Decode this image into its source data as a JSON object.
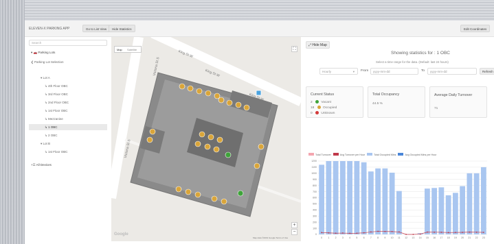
{
  "navbar": {
    "brand": "ELEVEN-X PARKING APP",
    "list_view_label": "Go to List View",
    "hide_stats_label": "Hide Statistics",
    "edit_coords_label": "Edit Coordinates"
  },
  "sidebar": {
    "search_placeholder": "Search",
    "parking_lots": "▾ 🚗 Parking Lots",
    "lot_selection": "❮ Parking Lot Selection",
    "lot_a": "▾ Lot A",
    "floors_a": [
      "↳ 4th Floor OBC",
      "↳ 3rd Floor OBC",
      "↳ 2nd Floor OBC",
      "↳ 1st Floor OBC",
      "↳ Mezzanine",
      "↳ 1 OBC",
      "↳ 2 OBC"
    ],
    "lot_b": "▾ Lot B",
    "floors_b": [
      "↳ 1st Floor OBC"
    ],
    "all_devices": "+☰ All Devices"
  },
  "map": {
    "tab_map": "Map",
    "tab_satellite": "Satellite",
    "streets": [
      "King St W",
      "King St W",
      "King St W",
      "Victoria St S",
      "Victoria St S"
    ],
    "attribution": "Map data ©2019 Google   Terms of Use",
    "google": "Google",
    "zoom_in": "+",
    "zoom_out": "−"
  },
  "panel": {
    "hide_map_label": "⤢ Hide Map",
    "title": "Showing statistics for : 1 OBC",
    "subtitle": "Select a time range for the data. (Default: last 24 hours)",
    "range_select": "Hourly",
    "from_label": "From",
    "from_placeholder": "yyyy-mm-dd",
    "to_label": "To",
    "to_placeholder": "yyyy-mm-dd",
    "refresh_label": "Refresh",
    "current_status": {
      "title": "Current Status",
      "vacant_count": "2",
      "vacant_label": "Vacant",
      "occupied_count": "18",
      "occupied_label": "Occupied",
      "unknown_count": "0",
      "unknown_label": "Unknown"
    },
    "total_occupancy": {
      "title": "Total Occupancy",
      "value": "44.5 %"
    },
    "daily_turnover": {
      "title": "Average Daily Turnover",
      "value": "71"
    }
  },
  "colors": {
    "vacant": "#3fa33a",
    "occupied": "#d9a53a",
    "unknown": "#d33a3a"
  },
  "chart_data": {
    "type": "bar",
    "legend": [
      {
        "name": "Total Turnover",
        "color": "#f4a6b0"
      },
      {
        "name": "Avg Turnover per Hour",
        "color": "#c0394a"
      },
      {
        "name": "Total Occupied Mins",
        "color": "#a9c6f0"
      },
      {
        "name": "Avg Occupied Mins per Hour",
        "color": "#4a86d8"
      }
    ],
    "categories": [
      "0",
      "1",
      "2",
      "3",
      "4",
      "5",
      "6",
      "7",
      "8",
      "9",
      "10",
      "11",
      "12",
      "13",
      "14",
      "15",
      "16",
      "17",
      "18",
      "19",
      "20",
      "21",
      "22",
      "23"
    ],
    "ylim": [
      0,
      1200
    ],
    "yticks": [
      0,
      100,
      200,
      300,
      400,
      500,
      600,
      700,
      800,
      900,
      1000,
      1100,
      1200
    ],
    "series": [
      {
        "name": "Total Occupied Mins",
        "type": "bar",
        "values": [
          1140,
          1200,
          1200,
          1200,
          1200,
          1200,
          1180,
          1030,
          1080,
          1080,
          1010,
          710,
          0,
          0,
          20,
          750,
          760,
          770,
          640,
          680,
          790,
          1000,
          1000,
          1100
        ]
      },
      {
        "name": "Total Turnover",
        "type": "line",
        "values": [
          30,
          25,
          20,
          22,
          18,
          20,
          26,
          40,
          50,
          48,
          46,
          40,
          0,
          0,
          5,
          38,
          36,
          35,
          30,
          32,
          34,
          38,
          36,
          34
        ]
      }
    ]
  }
}
